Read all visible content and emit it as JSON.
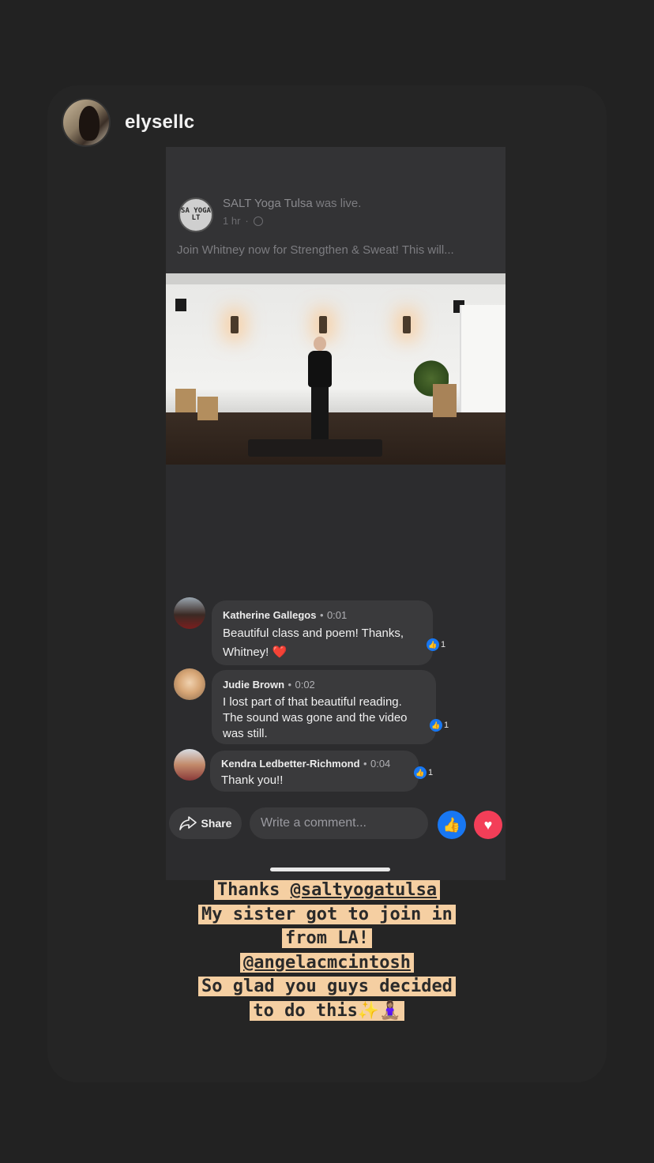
{
  "story": {
    "username": "elysellc"
  },
  "post": {
    "page_avatar_text": "SA YOGA LT",
    "page_name": "SALT Yoga Tulsa",
    "page_action": "was live.",
    "time": "1 hr",
    "text": "Join Whitney now for Strengthen & Sweat! This will..."
  },
  "comments": [
    {
      "name": "Katherine Gallegos",
      "time": "0:01",
      "line1": "Beautiful class and poem! Thanks,",
      "line2": "Whitney! ❤️",
      "reactions": "1"
    },
    {
      "name": "Judie Brown",
      "time": "0:02",
      "line1": "I lost part of that beautiful reading.",
      "line2": "The sound was gone and the video",
      "line3": "was still.",
      "reactions": "1"
    },
    {
      "name": "Kendra Ledbetter-Richmond",
      "time": "0:04",
      "line1": "Thank you!!",
      "reactions": "1"
    }
  ],
  "actions": {
    "share_label": "Share",
    "comment_placeholder": "Write a comment..."
  },
  "caption": {
    "line1_pre": "Thanks ",
    "line1_mention": "@saltyogatulsa",
    "line2": "My sister got to join in",
    "line3": "from LA!",
    "line4_mention": "@angelacmcintosh",
    "line5": "So glad you guys decided",
    "line6": "to do this✨🧘🏽‍♀️"
  },
  "colors": {
    "facebook_blue": "#1877f2",
    "love_red": "#f33e58",
    "caption_highlight": "#f5cfa2"
  }
}
